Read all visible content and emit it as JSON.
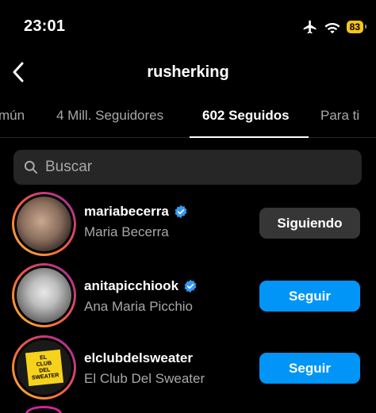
{
  "status_bar": {
    "time": "23:01",
    "battery": "83",
    "icons": [
      "airplane-icon",
      "wifi-icon",
      "battery-icon"
    ]
  },
  "header": {
    "title": "rusherking",
    "back_icon": "chevron-left-icon"
  },
  "tabs": [
    {
      "label": "mún",
      "active": false
    },
    {
      "label": "4 Mill. Seguidores",
      "active": false
    },
    {
      "label": "602 Seguidos",
      "active": true
    },
    {
      "label": "Para ti",
      "active": false
    }
  ],
  "search": {
    "placeholder": "Buscar",
    "icon": "search-icon"
  },
  "users": [
    {
      "username": "mariabecerra",
      "full_name": "Maria Becerra",
      "verified": true,
      "button_label": "Siguiendo",
      "button_state": "following"
    },
    {
      "username": "anitapicchiook",
      "full_name": "Ana Maria Picchio",
      "verified": true,
      "button_label": "Seguir",
      "button_state": "follow"
    },
    {
      "username": "elclubdelsweater",
      "full_name": "El Club Del Sweater",
      "verified": false,
      "button_label": "Seguir",
      "button_state": "follow",
      "avatar_text": [
        "EL",
        "CLUB",
        "DEL",
        "SWEATER"
      ]
    }
  ],
  "colors": {
    "accent": "#0095f6",
    "following_bg": "#363636",
    "muted_text": "#a8a8a8",
    "verified": "#3897f0",
    "battery": "#f5c518"
  }
}
